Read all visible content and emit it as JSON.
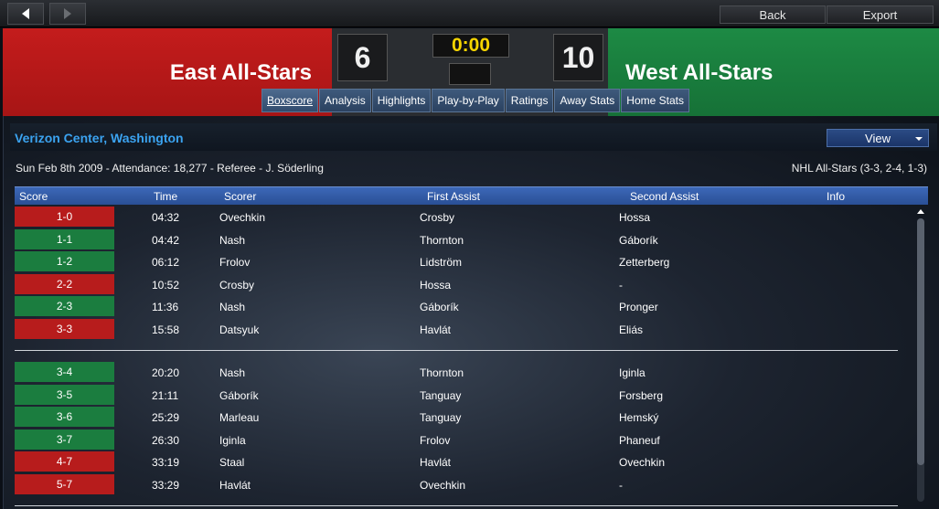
{
  "toolbar": {
    "back_label": "Back",
    "export_label": "Export"
  },
  "match": {
    "home_team": "East All-Stars",
    "away_team": "West All-Stars",
    "home_score": "6",
    "away_score": "10",
    "clock": "0:00"
  },
  "tabs": [
    {
      "label": "Boxscore",
      "active": true
    },
    {
      "label": "Analysis"
    },
    {
      "label": "Highlights"
    },
    {
      "label": "Play-by-Play"
    },
    {
      "label": "Ratings"
    },
    {
      "label": "Away Stats"
    },
    {
      "label": "Home Stats"
    }
  ],
  "venue": "Verizon Center, Washington",
  "view_label": "View",
  "info_left": "Sun Feb 8th 2009 - Attendance: 18,277 - Referee - J. Söderling",
  "info_right": "NHL All-Stars (3-3, 2-4, 1-3)",
  "columns": [
    "Score",
    "Time",
    "Scorer",
    "First Assist",
    "Second Assist",
    "Info"
  ],
  "colors": {
    "east": "#b71c1c",
    "west": "#1b7d3f",
    "accent": "#3ba3f0",
    "clock": "#f5d400"
  },
  "goals_period1": [
    {
      "score": "1-0",
      "team": "east",
      "time": "04:32",
      "scorer": "Ovechkin",
      "a1": "Crosby",
      "a2": "Hossa"
    },
    {
      "score": "1-1",
      "team": "west",
      "time": "04:42",
      "scorer": "Nash",
      "a1": "Thornton",
      "a2": "Gáborík"
    },
    {
      "score": "1-2",
      "team": "west",
      "time": "06:12",
      "scorer": "Frolov",
      "a1": "Lidström",
      "a2": "Zetterberg"
    },
    {
      "score": "2-2",
      "team": "east",
      "time": "10:52",
      "scorer": "Crosby",
      "a1": "Hossa",
      "a2": "-"
    },
    {
      "score": "2-3",
      "team": "west",
      "time": "11:36",
      "scorer": "Nash",
      "a1": "Gáborík",
      "a2": "Pronger"
    },
    {
      "score": "3-3",
      "team": "east",
      "time": "15:58",
      "scorer": "Datsyuk",
      "a1": "Havlát",
      "a2": "Eliás"
    }
  ],
  "goals_period2": [
    {
      "score": "3-4",
      "team": "west",
      "time": "20:20",
      "scorer": "Nash",
      "a1": "Thornton",
      "a2": "Iginla"
    },
    {
      "score": "3-5",
      "team": "west",
      "time": "21:11",
      "scorer": "Gáborík",
      "a1": "Tanguay",
      "a2": "Forsberg"
    },
    {
      "score": "3-6",
      "team": "west",
      "time": "25:29",
      "scorer": "Marleau",
      "a1": "Tanguay",
      "a2": "Hemský"
    },
    {
      "score": "3-7",
      "team": "west",
      "time": "26:30",
      "scorer": "Iginla",
      "a1": "Frolov",
      "a2": "Phaneuf"
    },
    {
      "score": "4-7",
      "team": "east",
      "time": "33:19",
      "scorer": "Staal",
      "a1": "Havlát",
      "a2": "Ovechkin"
    },
    {
      "score": "5-7",
      "team": "east",
      "time": "33:29",
      "scorer": "Havlát",
      "a1": "Ovechkin",
      "a2": "-"
    }
  ]
}
